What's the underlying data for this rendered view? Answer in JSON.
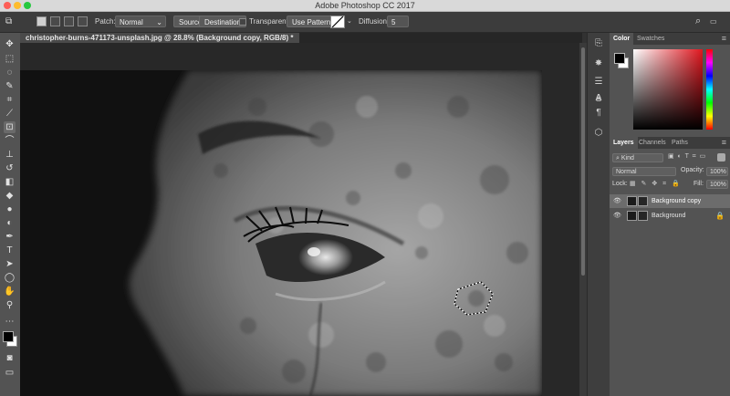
{
  "app": {
    "title": "Adobe Photoshop CC 2017"
  },
  "options_bar": {
    "patch_label": "Patch:",
    "patch_mode": "Normal",
    "source_label": "Source",
    "destination_label": "Destination",
    "transparent_label": "Transparent",
    "use_pattern_label": "Use Pattern",
    "diffusion_label": "Diffusion:",
    "diffusion_value": "5"
  },
  "document": {
    "tab_title": "christopher-burns-471173-unsplash.jpg @ 28.8% (Background copy, RGB/8) *"
  },
  "color_panel": {
    "tabs": [
      "Color",
      "Swatches"
    ],
    "foreground": "#000000",
    "background": "#ffffff"
  },
  "layers_panel": {
    "tabs": [
      "Layers",
      "Channels",
      "Paths"
    ],
    "filter_kind": "Kind",
    "blend_mode": "Normal",
    "opacity_label": "Opacity:",
    "opacity_value": "100%",
    "lock_label": "Lock:",
    "fill_label": "Fill:",
    "fill_value": "100%",
    "layers": [
      {
        "name": "Background copy",
        "selected": true
      },
      {
        "name": "Background",
        "locked": true
      }
    ]
  },
  "colors": {
    "panel_bg": "#535353",
    "selection": "#6c6c6c"
  }
}
